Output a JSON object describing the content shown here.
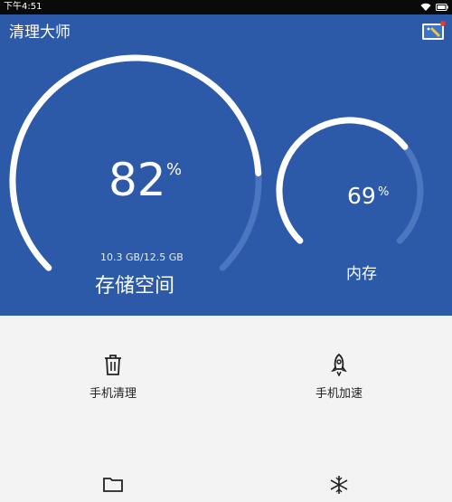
{
  "status_bar": {
    "time": "下午4:51"
  },
  "app": {
    "title": "清理大师"
  },
  "storage": {
    "percent": "82",
    "percent_sign": "%",
    "used_total": "10.3 GB/12.5 GB",
    "label": "存储空间",
    "fill_fraction": 0.82
  },
  "memory": {
    "percent": "69",
    "percent_sign": "%",
    "label": "内存",
    "fill_fraction": 0.69
  },
  "actions": [
    {
      "label": "手机清理",
      "icon": "trash-icon"
    },
    {
      "label": "手机加速",
      "icon": "rocket-icon"
    },
    {
      "label": "",
      "icon": "folder-icon"
    },
    {
      "label": "",
      "icon": "snowflake-icon"
    }
  ],
  "colors": {
    "header_bg": "#2c5aa9",
    "status_bar_bg": "#0a0a0a",
    "content_bg": "#f3f3f3",
    "gauge_track": "#4a77c0",
    "gauge_fill": "#ffffff"
  }
}
